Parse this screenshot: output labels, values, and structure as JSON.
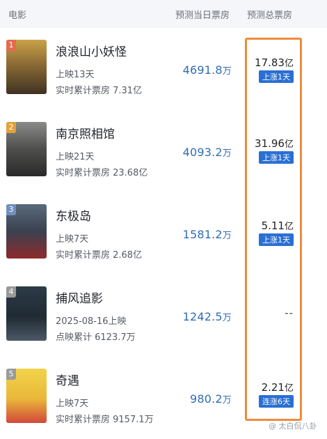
{
  "header": {
    "movie_label": "电影",
    "day_label": "预测当日票房",
    "total_label": "预测总票房"
  },
  "movies": [
    {
      "rank": "1",
      "title": "浪浪山小妖怪",
      "line1": "上映13天",
      "line2": "实时累计票房 7.31亿",
      "day_value": "4691.8",
      "day_unit": "万",
      "total_value": "17.83",
      "total_unit": "亿",
      "badge": "上涨1天",
      "poster_color": "#6d5a3a"
    },
    {
      "rank": "2",
      "title": "南京照相馆",
      "line1": "上映21天",
      "line2": "实时累计票房 23.68亿",
      "day_value": "4093.2",
      "day_unit": "万",
      "total_value": "31.96",
      "total_unit": "亿",
      "badge": "上涨1天",
      "poster_color": "#4a4a4a"
    },
    {
      "rank": "3",
      "title": "东极岛",
      "line1": "上映7天",
      "line2": "实时累计票房 2.68亿",
      "day_value": "1581.2",
      "day_unit": "万",
      "total_value": "5.11",
      "total_unit": "亿",
      "badge": "上涨1天",
      "poster_color": "#3a4150"
    },
    {
      "rank": "4",
      "title": "捕风追影",
      "line1": "2025-08-16上映",
      "line2": "点映累计 6123.7万",
      "day_value": "1242.5",
      "day_unit": "万",
      "total_value": "--",
      "total_unit": "",
      "badge": "",
      "poster_color": "#2c3a44"
    },
    {
      "rank": "5",
      "title": "奇遇",
      "line1": "上映7天",
      "line2": "实时累计票房 9157.1万",
      "day_value": "980.2",
      "day_unit": "万",
      "total_value": "2.21",
      "total_unit": "亿",
      "badge": "连涨6天",
      "poster_color": "#e9c23a"
    }
  ],
  "watermark": "@ 太白侃八卦",
  "colors": {
    "accent_blue": "#2a6fd3",
    "highlight_orange": "#f08b3a",
    "rank_badge": "#e46b4f"
  }
}
